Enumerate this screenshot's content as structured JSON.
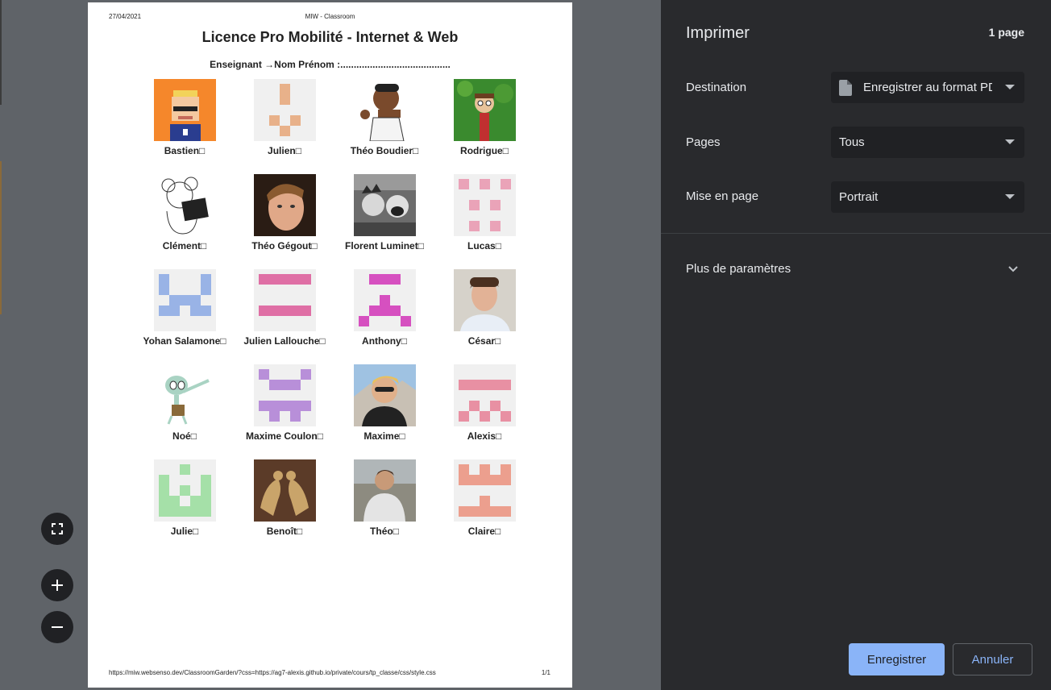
{
  "document": {
    "date": "27/04/2021",
    "header_title": "MIW - Classroom",
    "title": "Licence Pro Mobilité - Internet & Web",
    "teacher_line": "Enseignant →Nom Prénom :.........................................",
    "footer_url": "https://miw.websenso.dev/ClassroomGarden/?css=https://ag7-alexis.github.io/private/cours/tp_classe/css/style.css",
    "footer_page": "1/1"
  },
  "students": [
    [
      "Bastien□",
      "Julien□",
      "Théo Boudier□",
      "Rodrigue□"
    ],
    [
      "Clément□",
      "Théo Gégout□",
      "Florent Luminet□",
      "Lucas□"
    ],
    [
      "Yohan Salamone□",
      "Julien Lallouche□",
      "Anthony□",
      "César□"
    ],
    [
      "Noé□",
      "Maxime Coulon□",
      "Maxime□",
      "Alexis□"
    ],
    [
      "Julie□",
      "Benoît□",
      "Théo□",
      "Claire□"
    ]
  ],
  "avatar_colors": {
    "julien": "#e8b18a",
    "lucas": "#eaa3b8",
    "yohan": "#99b3e6",
    "julien_lallouche": "#df6fa5",
    "anthony": "#d650c0",
    "maxime_coulon": "#b88fd9",
    "alexis": "#e890a3",
    "julie": "#a5e0a8",
    "claire": "#ec9f8e"
  },
  "print_panel": {
    "title": "Imprimer",
    "page_count": "1 page",
    "destination_label": "Destination",
    "destination_value": "Enregistrer au format PDF",
    "pages_label": "Pages",
    "pages_value": "Tous",
    "layout_label": "Mise en page",
    "layout_value": "Portrait",
    "more_settings": "Plus de paramètres",
    "save_button": "Enregistrer",
    "cancel_button": "Annuler"
  },
  "icons": {
    "fit": "fit-to-page-icon",
    "zoom_in": "zoom-in-icon",
    "zoom_out": "zoom-out-icon",
    "file": "file-icon",
    "chevron": "chevron-down-icon"
  }
}
